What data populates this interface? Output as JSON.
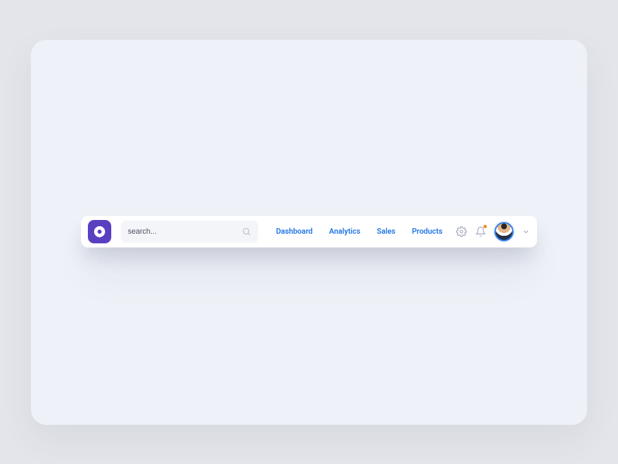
{
  "search": {
    "placeholder": "search..."
  },
  "nav": {
    "items": [
      {
        "label": "Dashboard"
      },
      {
        "label": "Analytics"
      },
      {
        "label": "Sales"
      },
      {
        "label": "Products"
      }
    ]
  },
  "notifications": {
    "has_unread": true
  }
}
